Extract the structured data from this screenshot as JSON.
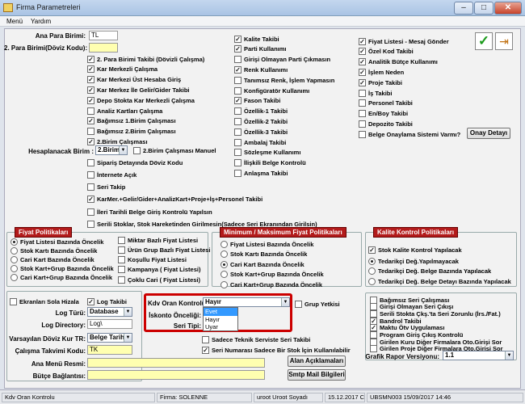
{
  "window": {
    "title": "Firma Parametreleri"
  },
  "menu": [
    "Menü",
    "Yardım"
  ],
  "toolbar": {
    "confirm_icon": "checkmark-icon",
    "exit_icon": "exit-door-icon"
  },
  "top": {
    "ana_para_label": "Ana Para Birimi:",
    "ana_para_value": "TL",
    "para2_label": "2. Para Birimi(Döviz Kodu):",
    "para2_value": "",
    "hesap_label": "Hesaplanacak Birim :",
    "hesap_value": "2.Birim",
    "col1": [
      {
        "label": "2. Para Birimi Takibi  (Dövizli Çalışma)",
        "checked": true
      },
      {
        "label": "Kar Merkezli Çalışma",
        "checked": true
      },
      {
        "label": "Kar Merkezi Üst Hesaba Giriş",
        "checked": true
      },
      {
        "label": "Kar Merkez İle Gelir/Gider Takibi",
        "checked": true
      },
      {
        "label": "Depo Stokta Kar Merkezli Çalışma",
        "checked": true
      },
      {
        "label": "Analiz Kartları Çalışma",
        "checked": false
      },
      {
        "label": "Bağımsız 1.Birim Çalışması",
        "checked": true
      },
      {
        "label": "Bağımsız 2.Birim Çalışması",
        "checked": false
      },
      {
        "label": "2.Birim Çalışması",
        "checked": true
      }
    ],
    "birim2_manuel": "2.Birim Çalışması Manuel",
    "col1b": [
      {
        "label": "Sipariş Detayında Döviz Kodu",
        "checked": false
      },
      {
        "label": "İnternete Açık",
        "checked": false
      },
      {
        "label": "Seri Takip",
        "checked": false
      },
      {
        "label": "KarMer.+Gelir/Gider+AnalizKart+Proje+İş+Personel Takibi",
        "checked": true
      },
      {
        "label": "İleri Tarihli Belge Giriş Kontrolü Yapılsın",
        "checked": false
      },
      {
        "label": "Serili Stoklar, Stok Hareketinden Girilmesin(Sadece Seri Ekranından Girilsin)",
        "checked": false
      }
    ],
    "col2": [
      {
        "label": "Kalite Takibi",
        "checked": true
      },
      {
        "label": "Parti Kullanımı",
        "checked": true
      },
      {
        "label": "Girişi Olmayan Parti Çıkmasın",
        "checked": false
      },
      {
        "label": "Renk Kullanımı",
        "checked": true
      },
      {
        "label": "Tanımsız Renk, İşlem Yapmasın",
        "checked": false
      },
      {
        "label": "Konfigüratör Kullanımı",
        "checked": false
      },
      {
        "label": "Fason Takibi",
        "checked": true
      },
      {
        "label": "Özellik-1 Takibi",
        "checked": false
      },
      {
        "label": "Özellik-2 Takibi",
        "checked": false
      },
      {
        "label": "Özellik-3 Takibi",
        "checked": false
      },
      {
        "label": "Ambalaj Takibi",
        "checked": false
      },
      {
        "label": "Sözleşme Kullanımı",
        "checked": false
      },
      {
        "label": "İlişkili Belge Kontrolü",
        "checked": false
      },
      {
        "label": "Anlaşma Takibi",
        "checked": false
      }
    ],
    "col3": [
      {
        "label": "Fiyat Listesi - Mesaj Gönder",
        "checked": true
      },
      {
        "label": "Özel Kod Takibi",
        "checked": true
      },
      {
        "label": "Analitik Bütçe Kullanımı",
        "checked": true
      },
      {
        "label": "İşlem Neden",
        "checked": true
      },
      {
        "label": "Proje Takibi",
        "checked": true
      },
      {
        "label": "İş Takibi",
        "checked": false
      },
      {
        "label": "Personel Takibi",
        "checked": false
      },
      {
        "label": "En/Boy Takibi",
        "checked": false
      },
      {
        "label": "Depozito Takibi",
        "checked": false
      },
      {
        "label": "Belge Onaylama Sistemi Varmı?",
        "checked": false
      }
    ],
    "onay_button": "Onay Detayı"
  },
  "fiyat": {
    "title": "Fiyat Politikaları",
    "radios": [
      {
        "label": "Fiyat Listesi Bazında Öncelik",
        "on": true
      },
      {
        "label": "Stok Kartı Bazında Öncelik",
        "on": false
      },
      {
        "label": "Cari Kart Bazında Öncelik",
        "on": false
      },
      {
        "label": "Stok Kart+Grup Bazında Öncelik",
        "on": false
      },
      {
        "label": "Cari Kart+Grup Bazında Öncelik",
        "on": false
      }
    ],
    "checks": [
      {
        "label": "Miktar Bazlı Fiyat Listesi",
        "checked": false
      },
      {
        "label": "Ürün Grup Bazlı Fiyat Listesi",
        "checked": false
      },
      {
        "label": "Koşullu Fiyat Listesi",
        "checked": false
      },
      {
        "label": "Kampanya ( Fiyat Listesi)",
        "checked": false
      },
      {
        "label": "Çoklu Cari ( Fiyat Listesi)",
        "checked": false
      }
    ]
  },
  "minmax": {
    "title": "Minimum / Maksimum Fiyat Politikaları",
    "radios": [
      {
        "label": "Fiyat Listesi Bazında Öncelik",
        "on": false
      },
      {
        "label": "Stok Kartı Bazında Öncelik",
        "on": false
      },
      {
        "label": "Cari Kart Bazında Öncelik",
        "on": true
      },
      {
        "label": "Stok Kart+Grup Bazında Öncelik",
        "on": false
      },
      {
        "label": "Cari Kart+Grup Bazında Öncelik",
        "on": false
      }
    ]
  },
  "kalite": {
    "title": "Kalite Kontrol Politikaları",
    "check": "Stok Kalite Kontrol Yapılacak",
    "radios": [
      {
        "label": "Tedarikçi Değ.Yapılmayacak",
        "on": true
      },
      {
        "label": "Tedarikçi Değ. Belge Bazında Yapılacak",
        "on": false
      },
      {
        "label": "Tedarikçi Değ. Belge Detayı Bazında Yapılacak",
        "on": false
      }
    ]
  },
  "bottom": {
    "ekran_sola": "Ekranları Sola Hizala",
    "log_takibi": "Log Takibi",
    "log_turu_label": "Log Türü:",
    "log_turu_value": "Database",
    "log_dir_label": "Log Directory:",
    "log_dir_value": "Log\\",
    "varsayilan_label": "Varsayılan Döviz Kur TR:",
    "varsayilan_value": "Belge Tarihi",
    "calisma_label": "Çalışma Takvimi Kodu:",
    "calisma_value": "TK",
    "ana_menu_label": "Ana Menü Resmi:",
    "ana_menu_value": "",
    "butce_label": "Bütçe Bağlantısı:",
    "butce_value": "",
    "kdv_label": "Kdv Oran Kontrolü:",
    "kdv_value": "Hayır",
    "dropdown_options": [
      "Evet",
      "Hayır",
      "Uyar"
    ],
    "iskonto_label": "İskonto Önceliği:",
    "seri_tipi_label": "Seri Tipi:",
    "grup_yetkisi": "Grup Yetkisi",
    "sadece_teknik": "Sadece Teknik Serviste Seri Takibi",
    "seri_numarasi": "Seri Numarası Sadece Bir Stok İçin Kullanılabilir",
    "alan_button": "Alan Açıklamaları",
    "smtp_button": "Smtp Mail Bilgileri",
    "right_checks": [
      {
        "label": "Bağımsız Seri Çalışması",
        "checked": false
      },
      {
        "label": "Girişi Olmayan Seri Çıkışı",
        "checked": false
      },
      {
        "label": "Serili Stokta Çkş.'ta Seri Zorunlu (İrs./Fat.)",
        "checked": false
      },
      {
        "label": "Bandrol Takibi",
        "checked": true
      },
      {
        "label": "Maktu Ötv Uygulaması",
        "checked": true
      },
      {
        "label": "Program Giriş Çıkış Kontrolü",
        "checked": false
      },
      {
        "label": "Girilen Kuru Diğer Firmalara Oto.Girişi Sor",
        "checked": false
      },
      {
        "label": "Girilen Proje Diğer Firmalara Oto.Girişi Sor",
        "checked": false
      }
    ],
    "grafik_label": "Grafik Rapor Versiyonu:",
    "grafik_value": "1.1"
  },
  "status": [
    "Kdv Oran Kontrolu",
    "Firma: SOLENNE",
    "uroot Uroot Soyadı",
    "15.12.2017  Cuma",
    "UBSMN003 15/09/2017 14:46"
  ],
  "colors": {
    "accent_red": "#b31b1b",
    "highlight": "#cc0000",
    "selection": "#3399ff"
  }
}
